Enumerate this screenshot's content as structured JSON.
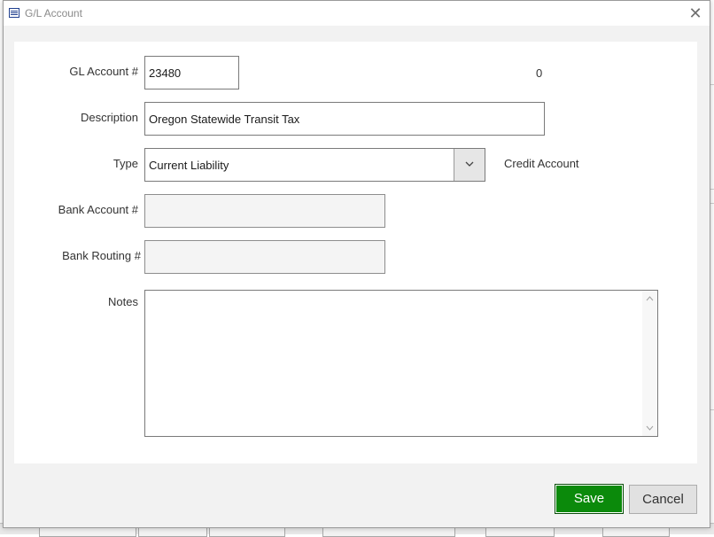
{
  "window": {
    "title": "G/L Account",
    "close_glyph": "✕"
  },
  "form": {
    "gl_account": {
      "label": "GL Account #",
      "value": "23480"
    },
    "status_value": "0",
    "description": {
      "label": "Description",
      "value": "Oregon Statewide Transit Tax"
    },
    "type": {
      "label": "Type",
      "value": "Current Liability"
    },
    "account_side": "Credit Account",
    "bank_account": {
      "label": "Bank Account #",
      "value": ""
    },
    "bank_routing": {
      "label": "Bank Routing #",
      "value": ""
    },
    "notes": {
      "label": "Notes",
      "value": ""
    }
  },
  "buttons": {
    "save_label": "Save",
    "cancel_label": "Cancel"
  },
  "colors": {
    "save_bg": "#0b8a0b",
    "cancel_bg": "#e1e1e1",
    "title_icon": "#1f3f8f"
  }
}
